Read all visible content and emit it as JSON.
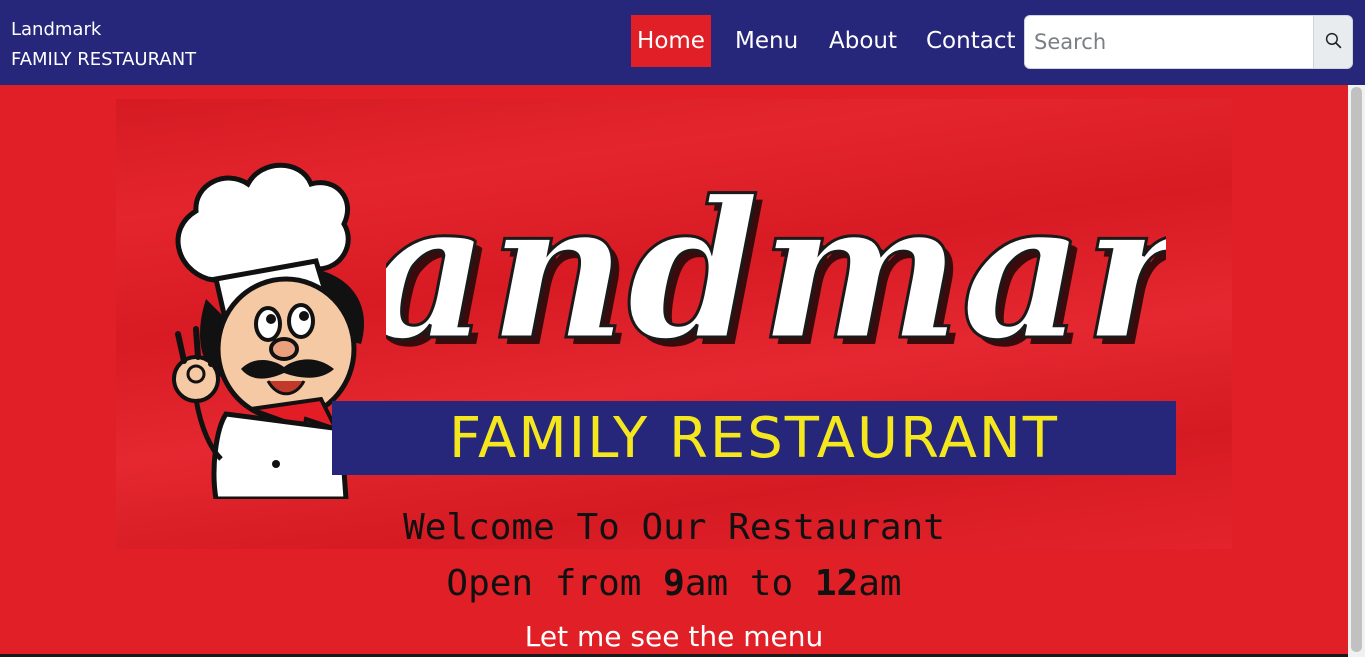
{
  "navbar": {
    "brand_line1": "Landmark",
    "brand_line2": "FAMILY RESTAURANT",
    "links": [
      {
        "label": "Home",
        "active": true
      },
      {
        "label": "Menu",
        "active": false
      },
      {
        "label": "About",
        "active": false
      },
      {
        "label": "Contact",
        "active": false
      }
    ],
    "search": {
      "placeholder": "Search",
      "value": "",
      "icon": "search-icon"
    }
  },
  "banner": {
    "logo_title": "Landmark",
    "logo_subtitle": "FAMILY RESTAURANT",
    "mascot": "chef-mascot"
  },
  "hero": {
    "welcome": "Welcome To Our Restaurant",
    "open_prefix": "Open from ",
    "open_start_num": "9",
    "open_start_unit": "am to ",
    "open_end_num": "12",
    "open_end_unit": "am",
    "menu_link": "Let me see the menu"
  },
  "colors": {
    "navbar_bg": "#26267a",
    "accent_red": "#e01f26",
    "subtitle_yellow": "#f5e71e"
  }
}
